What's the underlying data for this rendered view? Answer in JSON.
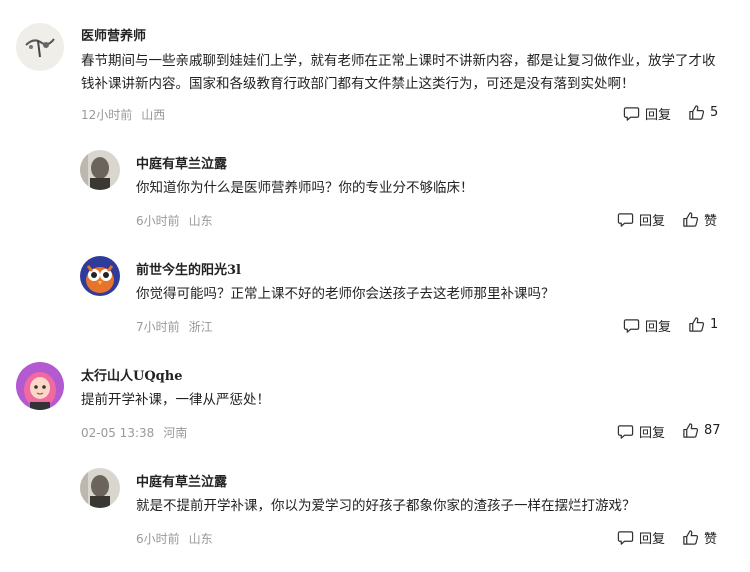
{
  "comments": [
    {
      "username": "医师营养师",
      "text": "春节期间与一些亲戚聊到娃娃们上学，就有老师在正常上课时不讲新内容，都是让复习做作业，放学了才收钱补课讲新内容。国家和各级教育行政部门都有文件禁止这类行为，可还是没有落到实处啊！",
      "time": "12小时前",
      "location": "山西",
      "reply_label": "回复",
      "like_count": "5"
    },
    {
      "username": "中庭有草兰泣露",
      "text": "你知道你为什么是医师营养师吗？你的专业分不够临床！",
      "time": "6小时前",
      "location": "山东",
      "reply_label": "回复",
      "like_count": "赞"
    },
    {
      "username": "前世今生的阳光3l",
      "text": "你觉得可能吗？正常上课不好的老师你会送孩子去这老师那里补课吗？",
      "time": "7小时前",
      "location": "浙江",
      "reply_label": "回复",
      "like_count": "1"
    },
    {
      "username": "太行山人UQqhe",
      "text": "提前开学补课，一律从严惩处！",
      "time": "02-05 13:38",
      "location": "河南",
      "reply_label": "回复",
      "like_count": "87"
    },
    {
      "username": "中庭有草兰泣露",
      "text": "就是不提前开学补课，你以为爱学习的好孩子都象你家的渣孩子一样在摆烂打游戏？",
      "time": "6小时前",
      "location": "山东",
      "reply_label": "回复",
      "like_count": "赞"
    }
  ],
  "colors": {
    "text": "#222222",
    "meta": "#999999",
    "background": "#ffffff"
  },
  "icons": {
    "reply": "speech-bubble-icon",
    "like": "thumbs-up-icon"
  }
}
